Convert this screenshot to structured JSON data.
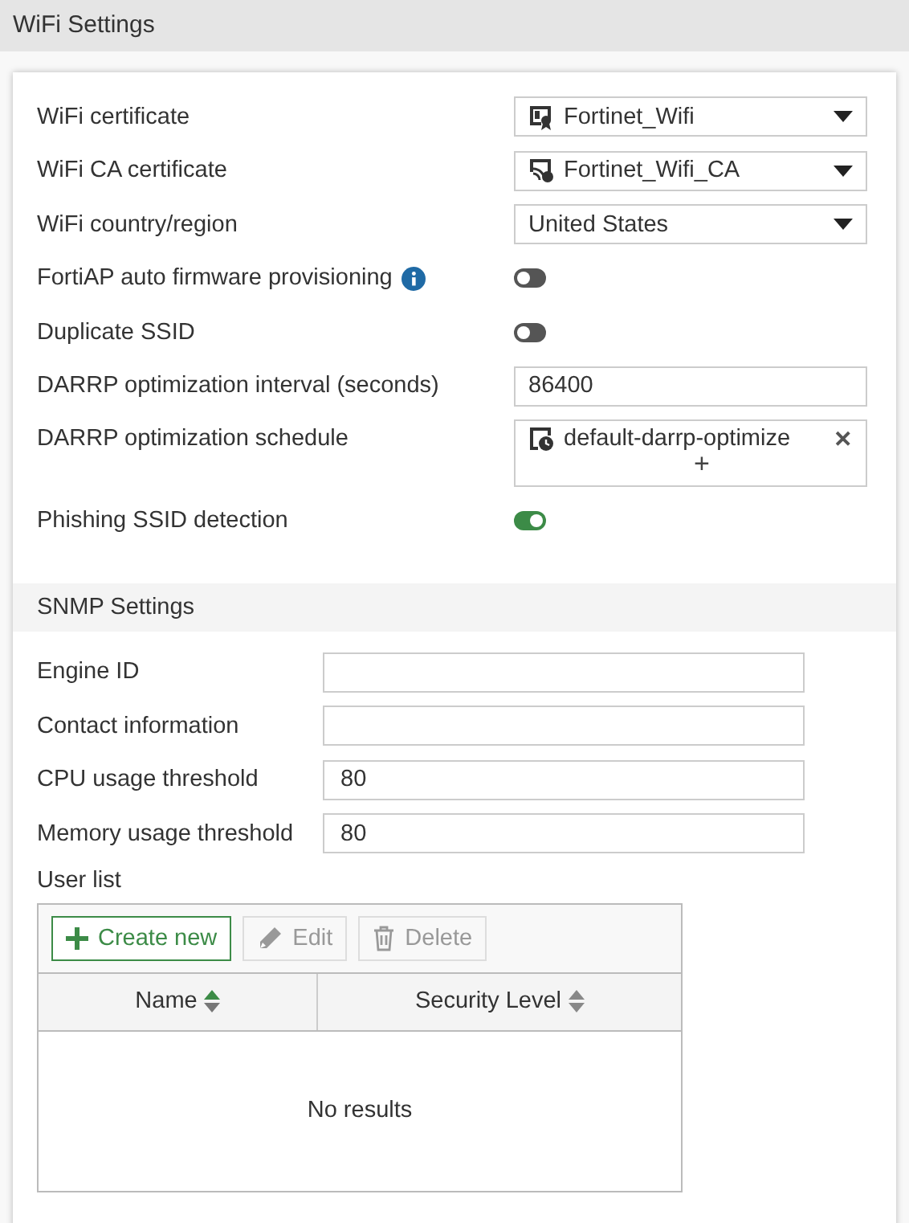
{
  "header": {
    "title": "WiFi Settings"
  },
  "wifi_rows": [
    {
      "kind": "certificate-select",
      "label": "WiFi certificate",
      "value": "Fortinet_Wifi"
    },
    {
      "kind": "ca-certificate-select",
      "label": "WiFi CA certificate",
      "value": "Fortinet_Wifi_CA"
    },
    {
      "kind": "select",
      "label": "WiFi country/region",
      "value": "United States"
    },
    {
      "kind": "toggle",
      "label": "FortiAP auto firmware provisioning",
      "info": true,
      "on": false
    },
    {
      "kind": "toggle",
      "label": "Duplicate SSID",
      "on": false
    },
    {
      "kind": "input",
      "label": "DARRP optimization interval (seconds)",
      "value": "86400"
    },
    {
      "kind": "schedule",
      "label": "DARRP optimization schedule",
      "value": "default-darrp-optimize",
      "remove": "✕",
      "add": "+"
    },
    {
      "kind": "toggle",
      "label": "Phishing SSID detection",
      "on": true
    }
  ],
  "snmp": {
    "title": "SNMP Settings",
    "fields": [
      {
        "label": "Engine ID"
      },
      {
        "label": "Contact information"
      },
      {
        "label": "CPU usage threshold",
        "value": "80"
      },
      {
        "label": "Memory usage threshold",
        "value": "80"
      }
    ],
    "user_list": {
      "label": "User list",
      "toolbar": [
        {
          "kind": "create",
          "label": "Create new",
          "disabled": false
        },
        {
          "kind": "edit",
          "label": "Edit",
          "disabled": true
        },
        {
          "kind": "delete",
          "label": "Delete",
          "disabled": true
        }
      ],
      "columns": [
        {
          "label": "Name",
          "sorted": true
        },
        {
          "label": "Security Level",
          "sorted": false
        }
      ],
      "empty_text": "No results"
    }
  }
}
